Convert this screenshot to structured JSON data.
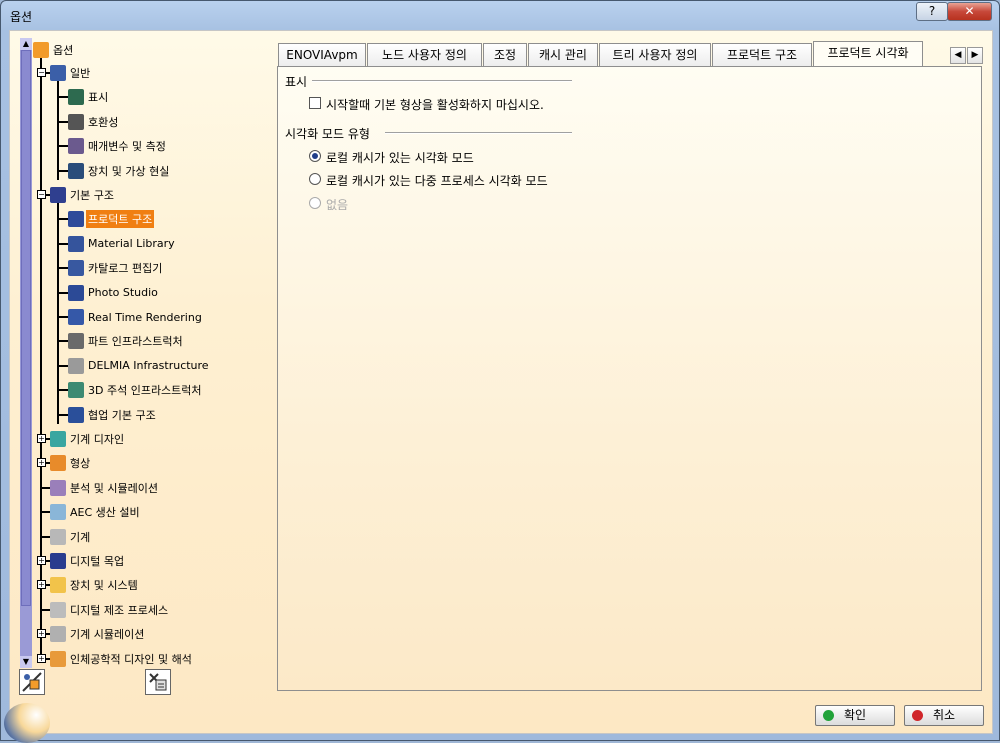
{
  "window": {
    "title": "옵션",
    "help_label": "?",
    "close_label": "✕"
  },
  "tree": {
    "root": "옵션",
    "items": [
      {
        "label": "일반",
        "icon": "general-icon",
        "color": "#3b5fa8"
      },
      {
        "label": "표시",
        "icon": "display-icon",
        "color": "#2d6a4f"
      },
      {
        "label": "호환성",
        "icon": "compat-icon",
        "color": "#555555"
      },
      {
        "label": "매개변수 및 측정",
        "icon": "param-icon",
        "color": "#6b5a8e"
      },
      {
        "label": "장치 및 가상 현실",
        "icon": "device-icon",
        "color": "#2a4d7a"
      },
      {
        "label": "기본 구조",
        "icon": "infra-icon",
        "color": "#2f3f8f"
      },
      {
        "label": "프로덕트 구조",
        "icon": "product-icon",
        "color": "#2f4b9a"
      },
      {
        "label": "Material Library",
        "icon": "material-icon",
        "color": "#35549c"
      },
      {
        "label": "카탈로그 편집기",
        "icon": "catalog-icon",
        "color": "#3858a0"
      },
      {
        "label": "Photo Studio",
        "icon": "photo-icon",
        "color": "#2c4a96"
      },
      {
        "label": "Real Time Rendering",
        "icon": "rtr-icon",
        "color": "#3558a8"
      },
      {
        "label": "파트 인프라스트럭처",
        "icon": "part-icon",
        "color": "#6a6a6a"
      },
      {
        "label": "DELMIA Infrastructure",
        "icon": "delmia-icon",
        "color": "#9a9a9a"
      },
      {
        "label": "3D 주석 인프라스트럭처",
        "icon": "annot-icon",
        "color": "#3d8a72"
      },
      {
        "label": "협업 기본 구조",
        "icon": "collab-icon",
        "color": "#2a4f9a"
      },
      {
        "label": "기계 디자인",
        "icon": "mech-icon",
        "color": "#3aa6a0"
      },
      {
        "label": "형상",
        "icon": "shape-icon",
        "color": "#e88b2a"
      },
      {
        "label": "분석 및 시뮬레이션",
        "icon": "analysis-icon",
        "color": "#9a7fba"
      },
      {
        "label": "AEC 생산 설비",
        "icon": "aec-icon",
        "color": "#8ab6d8"
      },
      {
        "label": "기계",
        "icon": "machining-icon",
        "color": "#b8b8b8"
      },
      {
        "label": "디지털 목업",
        "icon": "mockup-icon",
        "color": "#2a3c8e"
      },
      {
        "label": "장치 및 시스템",
        "icon": "systems-icon",
        "color": "#f2c34a"
      },
      {
        "label": "디지털 제조 프로세스",
        "icon": "dmp-icon",
        "color": "#bcbcbc"
      },
      {
        "label": "기계 시뮬레이션",
        "icon": "machsim-icon",
        "color": "#b0b0b0"
      },
      {
        "label": "인체공학적 디자인 및 해석",
        "icon": "ergo-icon",
        "color": "#e89a3a"
      }
    ]
  },
  "tabs": [
    "ENOVIAvpm",
    "노드 사용자 정의",
    "조정",
    "캐시 관리",
    "트리 사용자 정의",
    "프로덕트 구조",
    "프로덕트 시각화"
  ],
  "tab_nav": {
    "left": "◀",
    "right": "▶"
  },
  "panel": {
    "display_section": "표시",
    "checkbox_label": "시작할때 기본 형상을 활성화하지 마십시오.",
    "mode_section": "시각화 모드 유형",
    "radio1": "로컬 캐시가 있는 시각화 모드",
    "radio2": "로컬 캐시가 있는 다중 프로세스 시각화 모드",
    "radio3": "없음"
  },
  "buttons": {
    "ok": "확인",
    "cancel": "취소"
  },
  "colors": {
    "selection": "#f07f12",
    "ok_dot": "#22a33a",
    "cancel_dot": "#d0262a"
  }
}
